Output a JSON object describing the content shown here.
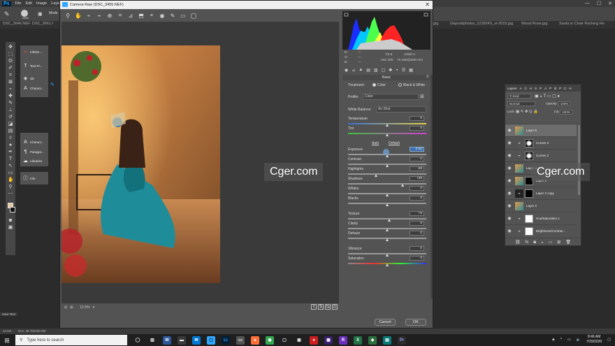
{
  "ps": {
    "logo": "Ps",
    "menu": [
      "File",
      "Edit",
      "Image",
      "Laye"
    ],
    "options_size": "2500",
    "options_mode_label": "Mode",
    "doc_tabs": [
      "DSC_3646.NEF",
      "DSC_3661.f",
      "jpg",
      "Depositphotos_121824S_xl-2015.jpg",
      "Wood Rose.jpg",
      "Santa in Chair Rocking Ho"
    ],
    "side_panel": [
      "Infinite ...",
      "Text Pr...",
      "3D",
      "Charact...",
      "Charact...",
      "Paragra...",
      "Libraries",
      "Info"
    ],
    "status_tip": "ntive Text",
    "status_zoom": "12.5%",
    "status_doc": "Doc: 36.7M/160.0M"
  },
  "camera_raw": {
    "title": "Camera Raw (DSC_3455.NEF)",
    "zoom": "12.5%",
    "info": {
      "r": "R:",
      "g": "G:",
      "b": "B:",
      "dash": "---",
      "aperture": "f/2.8",
      "shutter": "1/320 s",
      "iso": "ISO 200",
      "lens": "70-200@200 mm"
    },
    "panel_title": "Basic",
    "treatment_label": "Treatment:",
    "treatment_color": "Color",
    "treatment_bw": "Black & White",
    "profile_label": "Profile:",
    "profile_value": "Color",
    "wb_label": "White Balance:",
    "wb_value": "As Shot",
    "auto": "Auto",
    "default": "Default",
    "sliders": [
      {
        "label": "Temperature",
        "value": "0"
      },
      {
        "label": "Tint",
        "value": "0"
      },
      {
        "label": "Exposure",
        "value": "0.00"
      },
      {
        "label": "Contrast",
        "value": "0"
      },
      {
        "label": "Highlights",
        "value": "-28"
      },
      {
        "label": "Shadows",
        "value": "+39"
      },
      {
        "label": "Whites",
        "value": "0"
      },
      {
        "label": "Blacks",
        "value": "0"
      },
      {
        "label": "Texture",
        "value": "+6"
      },
      {
        "label": "Clarity",
        "value": "0"
      },
      {
        "label": "Dehaze",
        "value": "0"
      },
      {
        "label": "Vibrance",
        "value": "0"
      },
      {
        "label": "Saturation",
        "value": "0"
      }
    ],
    "cancel": "Cancel",
    "ok": "OK"
  },
  "layers": {
    "tabs": [
      "Layers",
      "A",
      "C",
      "H",
      "S",
      "P",
      "A",
      "P",
      "B",
      "P",
      "C",
      "H"
    ],
    "kind": "Kind",
    "blend": "Normal",
    "opacity_label": "Opacity:",
    "opacity": "100%",
    "lock_label": "Lock:",
    "fill_label": "Fill:",
    "fill": "100%",
    "items": [
      {
        "name": "Layer 5",
        "kind": "photo",
        "selected": true
      },
      {
        "name": "Curves 3",
        "kind": "adj",
        "selected": false
      },
      {
        "name": "Curves 2",
        "kind": "adj",
        "selected": false
      },
      {
        "name": "Layer 4",
        "kind": "photo",
        "selected": false
      },
      {
        "name": "Layer 3",
        "kind": "photo-mask",
        "selected": false
      },
      {
        "name": "Layer 2 copy",
        "kind": "dark-mask",
        "selected": false
      },
      {
        "name": "Layer 2",
        "kind": "photo",
        "selected": false
      },
      {
        "name": "Hue/Saturation 1",
        "kind": "adj-white",
        "selected": false
      },
      {
        "name": "Brightness/Contras...",
        "kind": "adj-white",
        "selected": false
      }
    ]
  },
  "watermark": "Cger.com",
  "taskbar": {
    "search_placeholder": "Type here to search",
    "time": "8:46 AM",
    "date": "7/29/2020"
  }
}
